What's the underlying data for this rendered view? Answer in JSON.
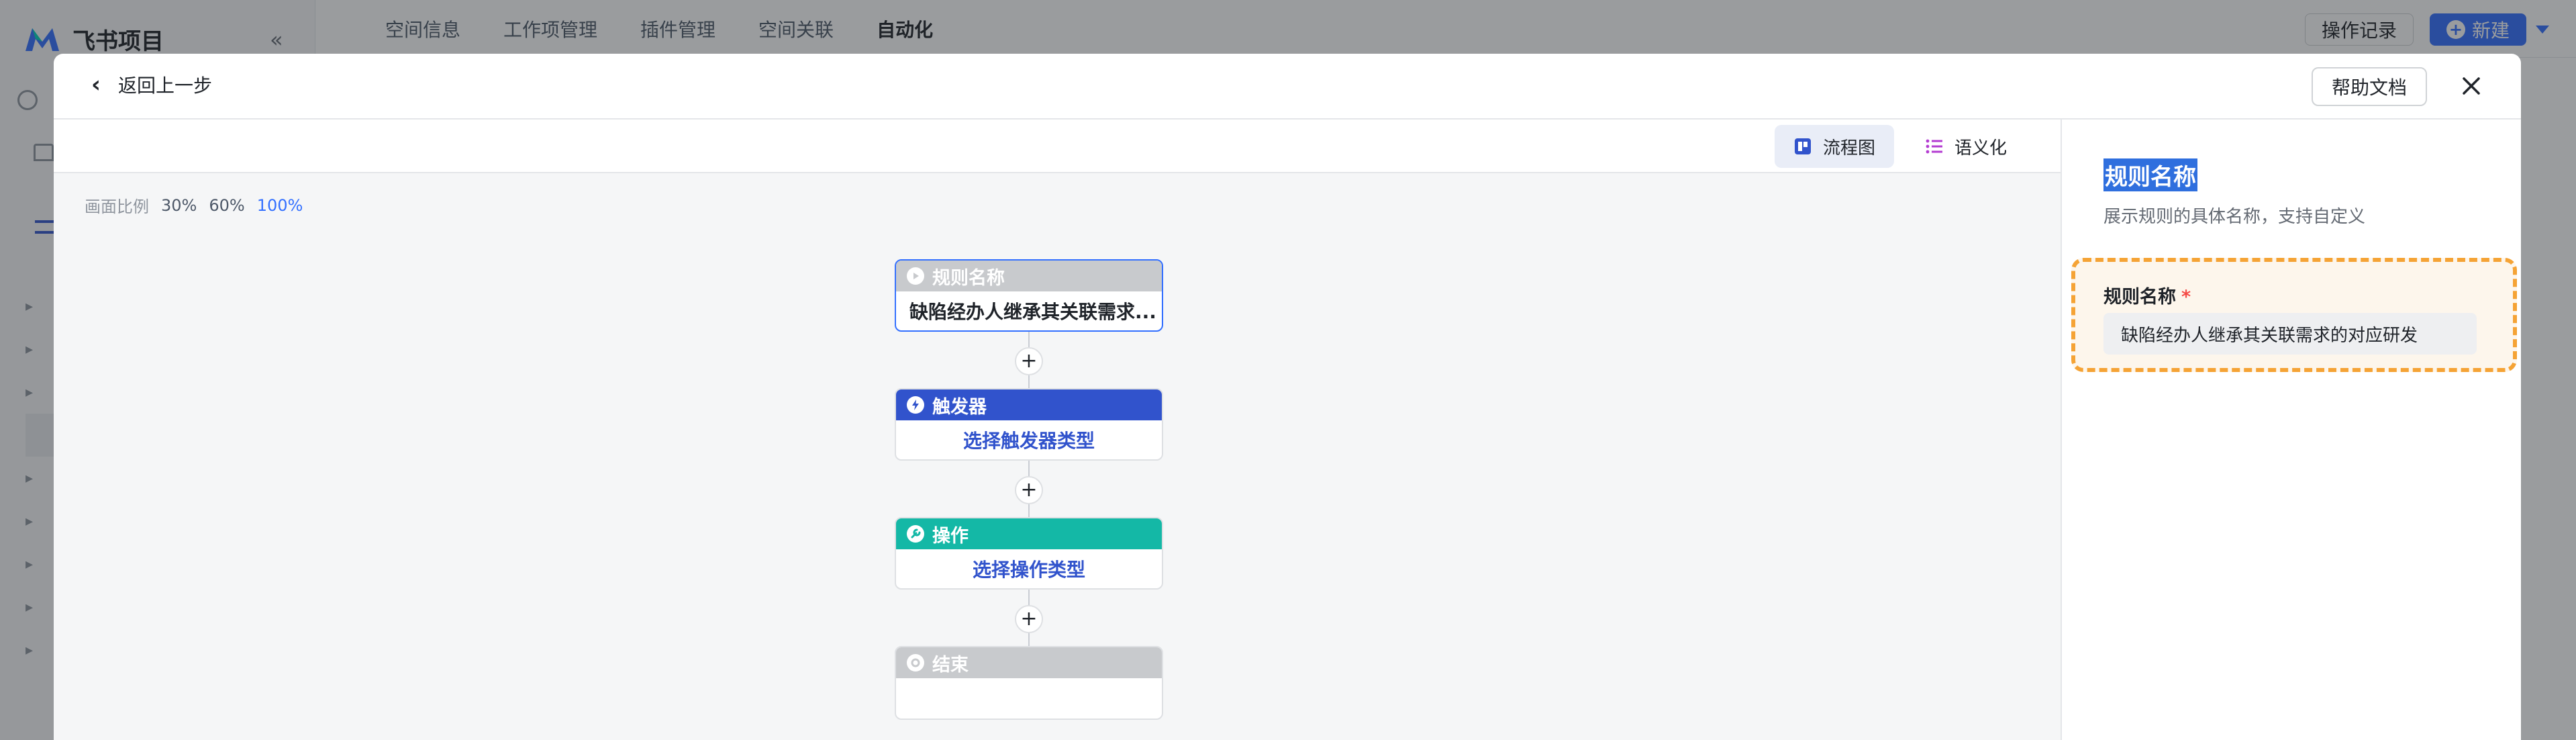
{
  "app": {
    "title": "飞书项目",
    "nav_tabs": [
      "空间信息",
      "工作项管理",
      "插件管理",
      "空间关联",
      "自动化"
    ],
    "active_tab": "自动化",
    "ops_log_label": "操作记录",
    "new_label": "新建"
  },
  "modal": {
    "back_label": "返回上一步",
    "help_label": "帮助文档",
    "views": [
      {
        "label": "流程图",
        "icon": "flowchart-icon",
        "active": true
      },
      {
        "label": "语义化",
        "icon": "list-icon",
        "active": false
      }
    ],
    "zoom": {
      "label": "画面比例",
      "options": [
        "30%",
        "60%",
        "100%"
      ],
      "active": "100%"
    },
    "flow": {
      "nodes": [
        {
          "title": "规则名称",
          "body": "缺陷经办人继承其关联需求...",
          "color": "#c8cacd"
        },
        {
          "title": "触发器",
          "body": "选择触发器类型",
          "color": "#3153cc"
        },
        {
          "title": "操作",
          "body": "选择操作类型",
          "color": "#14b8a6"
        },
        {
          "title": "结束",
          "body": "",
          "color": "#c8cacd"
        }
      ],
      "add_label": "+"
    }
  },
  "panel": {
    "title": "规则名称",
    "description": "展示规则的具体名称，支持自定义",
    "field_label": "规则名称",
    "required_mark": "*",
    "field_value": "缺陷经办人继承其关联需求的对应研发"
  },
  "colors": {
    "primary": "#3370ff",
    "highlight_border": "#f5a335",
    "trigger": "#3153cc",
    "action": "#14b8a6"
  }
}
